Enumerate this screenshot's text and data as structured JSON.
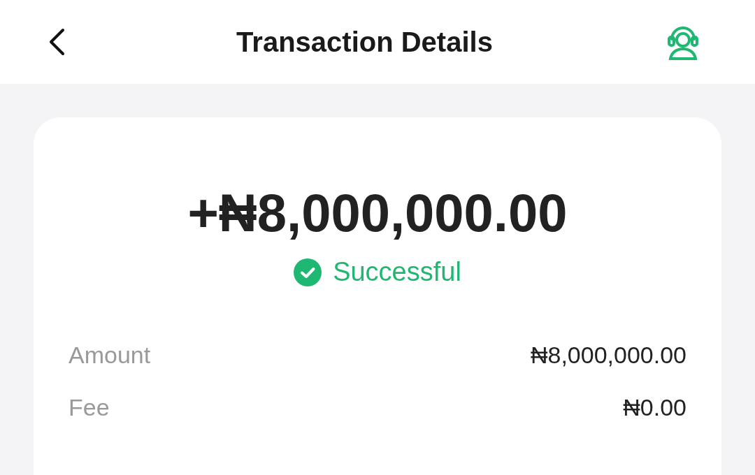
{
  "header": {
    "title": "Transaction Details"
  },
  "summary": {
    "amount": "+₦8,000,000.00",
    "status": {
      "label": "Successful",
      "kind": "success"
    }
  },
  "details": [
    {
      "label": "Amount",
      "value": "₦8,000,000.00"
    },
    {
      "label": "Fee",
      "value": "₦0.00"
    }
  ]
}
